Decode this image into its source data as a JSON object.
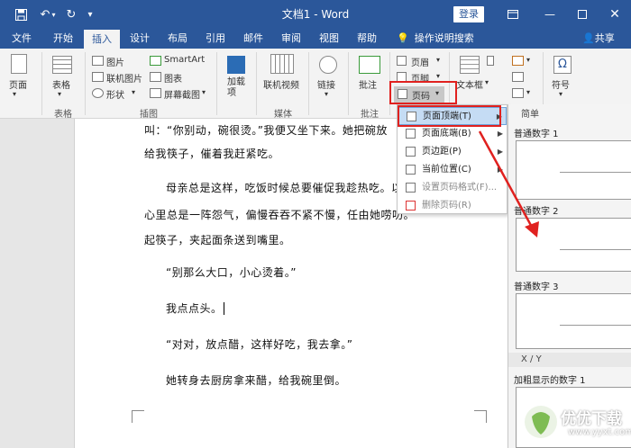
{
  "titlebar": {
    "doc_title": "文档1  -  Word",
    "login": "登录"
  },
  "tabs": [
    {
      "label": "文件"
    },
    {
      "label": "开始"
    },
    {
      "label": "插入"
    },
    {
      "label": "设计"
    },
    {
      "label": "布局"
    },
    {
      "label": "引用"
    },
    {
      "label": "邮件"
    },
    {
      "label": "审阅"
    },
    {
      "label": "视图"
    },
    {
      "label": "帮助"
    }
  ],
  "tellme": "操作说明搜索",
  "share": "共享",
  "ribbon": {
    "page": "页面",
    "table": "表格",
    "table_group": "表格",
    "picture": "图片",
    "online_picture": "联机图片",
    "shapes": "形状",
    "smartart": "SmartArt",
    "chart": "图表",
    "screenshot": "屏幕截图",
    "illustrations_group": "插图",
    "addins": "加载\n项",
    "online_video": "联机视频",
    "media_group": "媒体",
    "link": "链接",
    "comment": "批注",
    "comment_group": "批注",
    "header": "页眉",
    "footer": "页脚",
    "page_number": "页码",
    "textbox": "文本框",
    "symbol": "符号"
  },
  "document": {
    "p1": "叫：“你别动，碗很烫。”我便又坐下来。她把碗放",
    "p2": "给我筷子，催着我赶紧吃。",
    "p3": "母亲总是这样，吃饭时候总要催促我趁热吃。以",
    "p4": "心里总是一阵怨气，偏慢吞吞不紧不慢，任由她唠叨。",
    "p5": "起筷子，夹起面条送到嘴里。",
    "p6": "“别那么大口，小心烫着。”",
    "p7": "我点点头。",
    "p8": "“对对，放点醋，这样好吃，我去拿。”",
    "p9": "她转身去厨房拿来醋，给我碗里倒。"
  },
  "menu": {
    "top_of_page": "页面顶端(T)",
    "bottom_of_page": "页面底端(B)",
    "page_margins": "页边距(P)",
    "current_position": "当前位置(C)",
    "format_page_numbers": "设置页码格式(F)...",
    "remove_page_numbers": "删除页码(R)"
  },
  "gallery": {
    "section_simple": "简单",
    "plain_number_1": "普通数字 1",
    "plain_number_2": "普通数字 2",
    "plain_number_3": "普通数字 3",
    "section_xy": "X / Y",
    "bold_number_1": "加粗显示的数字 1"
  },
  "watermark": {
    "text": "优优下载",
    "url": "www.yyxt.com"
  },
  "colors": {
    "accent": "#2b579a",
    "highlight_red": "#e0211f",
    "menu_highlight": "#c5dcf4"
  }
}
